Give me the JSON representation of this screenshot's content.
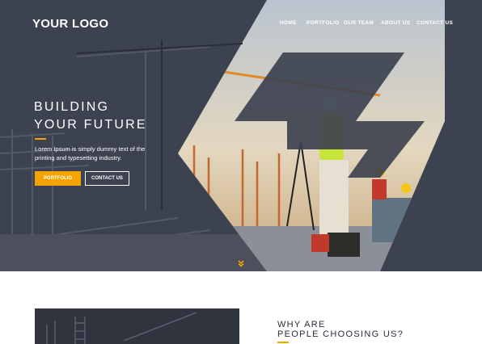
{
  "header": {
    "logo": "YOUR LOGO",
    "nav": [
      "HOME",
      "PORTFOLIO",
      "OUR TEAM",
      "ABOUT US",
      "CONTACT US"
    ],
    "active_nav": "PORTFOLIO"
  },
  "hero": {
    "title_line1": "BUILDING",
    "title_line2": "YOUR FUTURE",
    "text_line1": "Lorem Ipsum is simply dummy text of the",
    "text_line2": "printing and typesetting industry.",
    "primary_button": "PORTFOLIO",
    "secondary_button": "CONTACT US",
    "scroll_icon": "double-chevron-down-icon"
  },
  "section": {
    "heading_line1": "WHY ARE",
    "heading_line2": "PEOPLE CHOOSING US?"
  },
  "colors": {
    "accent": "#f4a300",
    "overlay": "#3a3f4d",
    "text_dark": "#2a2d3a"
  }
}
